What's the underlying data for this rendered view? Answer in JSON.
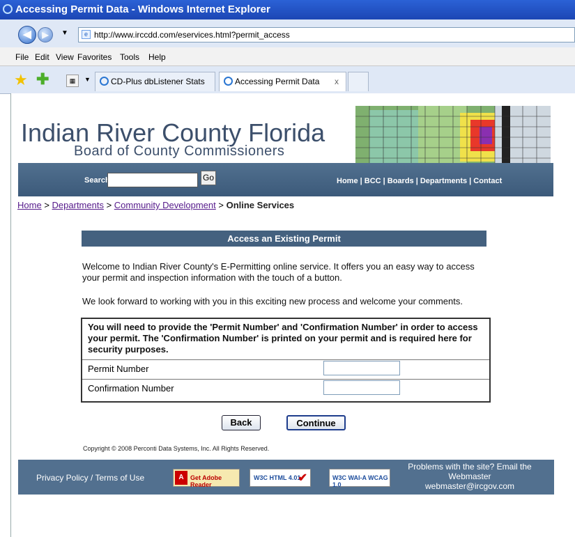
{
  "window": {
    "title": "Accessing Permit Data - Windows Internet Explorer"
  },
  "address": {
    "url": "http://www.irccdd.com/eservices.html?permit_access"
  },
  "menu": [
    "File",
    "Edit",
    "View",
    "Favorites",
    "Tools",
    "Help"
  ],
  "tabs": [
    {
      "label": "CD-Plus dbListener Stats"
    },
    {
      "label": "Accessing Permit Data",
      "close": "x"
    }
  ],
  "site": {
    "title": "Indian River County Florida",
    "subtitle": "Board of County Commissioners",
    "search_label": "Search",
    "go_label": "Go",
    "nav": "Home | BCC | Boards | Departments | Contact"
  },
  "breadcrumb": {
    "home": "Home",
    "sep": ">",
    "departments": "Departments",
    "community": "Community Development",
    "current": "Online Services"
  },
  "panel": {
    "title": "Access an Existing Permit",
    "welcome": "Welcome to Indian River County's E-Permitting online service. It offers you an easy way to access your permit and inspection information with the touch of a button.",
    "forward": "We look forward to working with you in this exciting new process and welcome your comments."
  },
  "form": {
    "note": "You will need to provide the 'Permit Number' and 'Confirmation Number' in order to access your permit. The 'Confirmation Number' is printed on your permit and is required here for security purposes.",
    "permit_label": "Permit Number",
    "permit_value": "",
    "confirmation_label": "Confirmation Number",
    "confirmation_value": ""
  },
  "buttons": {
    "back": "Back",
    "continue": "Continue"
  },
  "copyright": "Copyright © 2008 Perconti Data Systems, Inc. All Rights Reserved.",
  "footer": {
    "privacy": "Privacy Policy / Terms of Use",
    "adobe": "Get Adobe Reader",
    "html_badge": "W3C HTML 4.01",
    "wai_badge": "W3C WAI-A WCAG 1.0",
    "problems": "Problems with the site? Email the Webmaster",
    "email": "webmaster@ircgov.com"
  },
  "colors": {
    "titlebar": "#2458cc",
    "banner": "#44617f",
    "link": "#551a8b"
  }
}
